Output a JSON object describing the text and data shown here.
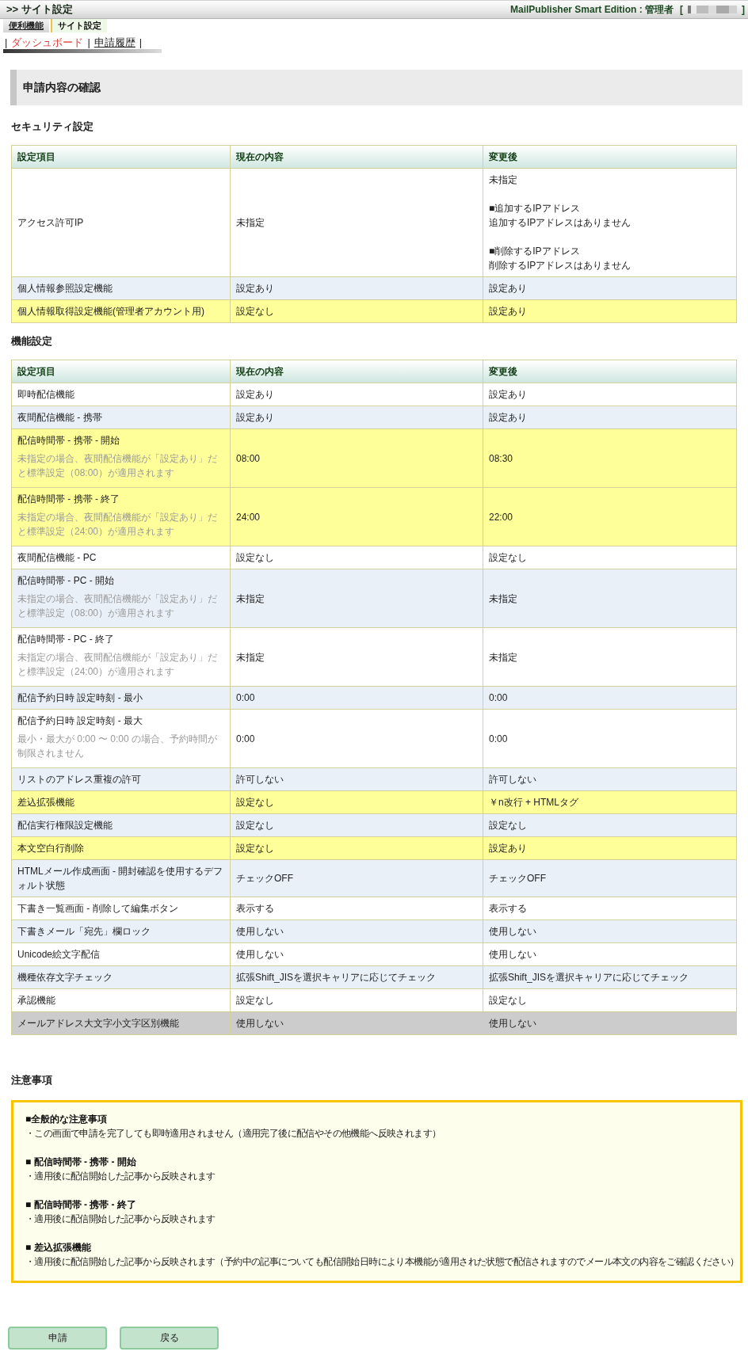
{
  "header": {
    "title": ">> サイト設定",
    "account_label": "MailPublisher Smart Edition : 管理者",
    "bracket_open": "[",
    "bracket_close": "]"
  },
  "tabs": [
    {
      "label": "便利機能",
      "selected": false
    },
    {
      "label": "サイト設定",
      "selected": true
    }
  ],
  "subnav": {
    "separators": [
      "|",
      "|",
      "|"
    ],
    "links": [
      {
        "label": "ダッシュボード",
        "selected": true
      },
      {
        "label": "申請履歴",
        "selected": false
      }
    ]
  },
  "page_title": "申請内容の確認",
  "sections": [
    {
      "title": "セキュリティ設定",
      "columns": [
        "設定項目",
        "現在の内容",
        "変更後"
      ],
      "rows": [
        {
          "item": "アクセス許可IP",
          "current": "未指定",
          "after": [
            [
              "未指定"
            ],
            [
              "■追加するIPアドレス",
              "追加するIPアドレスはありません"
            ],
            [
              "■削除するIPアドレス",
              "削除するIPアドレスはありません"
            ]
          ],
          "changed": false,
          "hovered": false
        },
        {
          "item": "個人情報参照設定機能",
          "current": "設定あり",
          "after": "設定あり",
          "changed": false,
          "hovered": false
        },
        {
          "item": "個人情報取得設定機能(管理者アカウント用)",
          "current": "設定なし",
          "after": "設定あり",
          "changed": true,
          "hovered": false
        }
      ]
    },
    {
      "title": "機能設定",
      "columns": [
        "設定項目",
        "現在の内容",
        "変更後"
      ],
      "rows": [
        {
          "item": "即時配信機能",
          "current": "設定あり",
          "after": "設定あり",
          "changed": false,
          "hovered": false
        },
        {
          "item": "夜間配信機能 - 携帯",
          "current": "設定あり",
          "after": "設定あり",
          "changed": false,
          "hovered": false
        },
        {
          "item": "配信時間帯 - 携帯 - 開始",
          "note": "未指定の場合、夜間配信機能が「設定あり」だと標準設定（08:00）が適用されます",
          "current": "08:00",
          "after": "08:30",
          "changed": true,
          "hovered": false
        },
        {
          "item": "配信時間帯 - 携帯 - 終了",
          "note": "未指定の場合、夜間配信機能が「設定あり」だと標準設定（24:00）が適用されます",
          "current": "24:00",
          "after": "22:00",
          "changed": true,
          "hovered": false
        },
        {
          "item": "夜間配信機能 - PC",
          "current": "設定なし",
          "after": "設定なし",
          "changed": false,
          "hovered": false
        },
        {
          "item": "配信時間帯 - PC - 開始",
          "note": "未指定の場合、夜間配信機能が「設定あり」だと標準設定（08:00）が適用されます",
          "current": "未指定",
          "after": "未指定",
          "changed": false,
          "hovered": false
        },
        {
          "item": "配信時間帯 - PC - 終了",
          "note": "未指定の場合、夜間配信機能が「設定あり」だと標準設定（24:00）が適用されます",
          "current": "未指定",
          "after": "未指定",
          "changed": false,
          "hovered": false
        },
        {
          "item": "配信予約日時 設定時刻 - 最小",
          "current": "0:00",
          "after": "0:00",
          "changed": false,
          "hovered": false
        },
        {
          "item": "配信予約日時 設定時刻 - 最大",
          "note": "最小・最大が 0:00 〜 0:00 の場合、予約時間が制限されません",
          "current": "0:00",
          "after": "0:00",
          "changed": false,
          "hovered": false
        },
        {
          "item": "リストのアドレス重複の許可",
          "current": "許可しない",
          "after": "許可しない",
          "changed": false,
          "hovered": false
        },
        {
          "item": "差込拡張機能",
          "current": "設定なし",
          "after": "￥n改行 + HTMLタグ",
          "changed": true,
          "hovered": false
        },
        {
          "item": "配信実行権限設定機能",
          "current": "設定なし",
          "after": "設定なし",
          "changed": false,
          "hovered": false
        },
        {
          "item": "本文空白行削除",
          "current": "設定なし",
          "after": "設定あり",
          "changed": true,
          "hovered": false
        },
        {
          "item": "HTMLメール作成画面 - 開封確認を使用するデフォルト状態",
          "current": "チェックOFF",
          "after": "チェックOFF",
          "changed": false,
          "hovered": false
        },
        {
          "item": "下書き一覧画面 - 削除して編集ボタン",
          "current": "表示する",
          "after": "表示する",
          "changed": false,
          "hovered": false
        },
        {
          "item": "下書きメール「宛先」欄ロック",
          "current": "使用しない",
          "after": "使用しない",
          "changed": false,
          "hovered": false
        },
        {
          "item": "Unicode絵文字配信",
          "current": "使用しない",
          "after": "使用しない",
          "changed": false,
          "hovered": false
        },
        {
          "item": "機種依存文字チェック",
          "current": "拡張Shift_JISを選択キャリアに応じてチェック",
          "after": "拡張Shift_JISを選択キャリアに応じてチェック",
          "changed": false,
          "hovered": false
        },
        {
          "item": "承認機能",
          "current": "設定なし",
          "after": "設定なし",
          "changed": false,
          "hovered": false
        },
        {
          "item": "メールアドレス大文字小文字区別機能",
          "current": "使用しない",
          "after": "使用しない",
          "changed": false,
          "hovered": true
        }
      ]
    }
  ],
  "notes": {
    "title": "注意事項",
    "items": [
      {
        "heading": "■全般的な注意事項",
        "body": "・この画面で申請を完了しても即時適用されません（適用完了後に配信やその他機能へ反映されます）"
      },
      {
        "heading": "■ 配信時間帯 - 携帯 - 開始",
        "body": "・適用後に配信開始した記事から反映されます"
      },
      {
        "heading": "■ 配信時間帯 - 携帯 - 終了",
        "body": "・適用後に配信開始した記事から反映されます"
      },
      {
        "heading": "■ 差込拡張機能",
        "body": "・適用後に配信開始した記事から反映されます（予約中の記事についても配信開始日時により本機能が適用された状態で配信されますのでメール本文の内容をご確認ください）"
      }
    ]
  },
  "buttons": [
    "申請",
    "戻る"
  ]
}
